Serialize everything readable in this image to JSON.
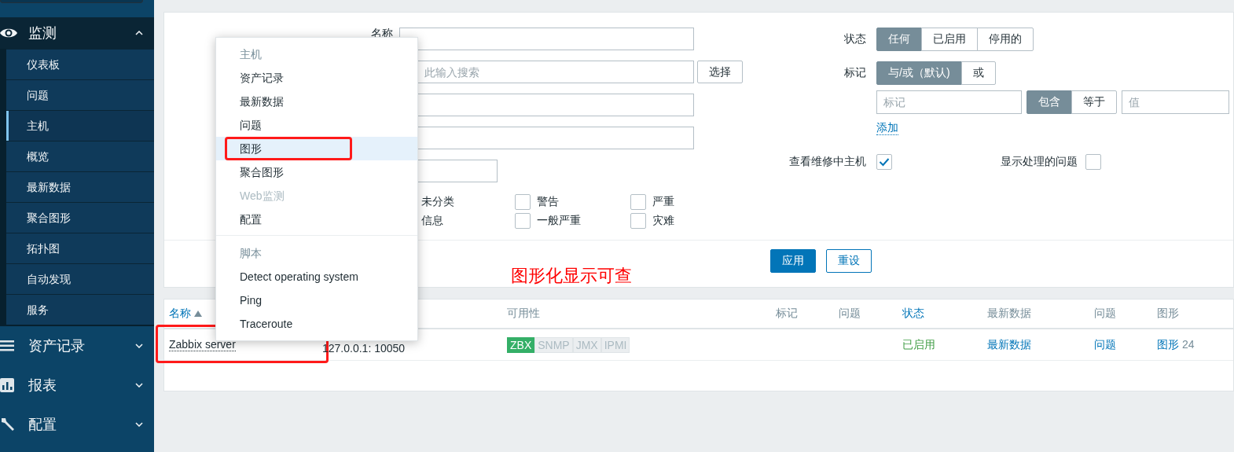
{
  "sidebar": {
    "sections": [
      {
        "label": "监测",
        "expanded": true,
        "items": [
          {
            "label": "仪表板",
            "selected": false
          },
          {
            "label": "问题",
            "selected": false
          },
          {
            "label": "主机",
            "selected": true
          },
          {
            "label": "概览",
            "selected": false
          },
          {
            "label": "最新数据",
            "selected": false
          },
          {
            "label": "聚合图形",
            "selected": false
          },
          {
            "label": "拓扑图",
            "selected": false
          },
          {
            "label": "自动发现",
            "selected": false
          },
          {
            "label": "服务",
            "selected": false
          }
        ]
      },
      {
        "label": "资产记录",
        "expanded": false
      },
      {
        "label": "报表",
        "expanded": false
      },
      {
        "label": "配置",
        "expanded": false
      }
    ]
  },
  "filter": {
    "fields": [
      {
        "kind": "text",
        "label": "名称"
      },
      {
        "kind": "picker",
        "placeholder": "此输入搜索",
        "button": "选择"
      },
      {
        "kind": "text"
      },
      {
        "kind": "text"
      },
      {
        "kind": "short"
      }
    ],
    "severities": [
      {
        "label": "未分类"
      },
      {
        "label": "警告",
        "checked": false
      },
      {
        "label": "严重",
        "checked": false
      },
      {
        "label": "信息"
      },
      {
        "label": "一般严重",
        "checked": false
      },
      {
        "label": "灾难",
        "checked": false
      }
    ],
    "status": {
      "label": "状态",
      "options": [
        {
          "label": "任何",
          "selected": true
        },
        {
          "label": "已启用",
          "selected": false
        },
        {
          "label": "停用的",
          "selected": false
        }
      ]
    },
    "tags": {
      "label": "标记",
      "operators": [
        {
          "label": "与/或（默认)",
          "selected": true
        },
        {
          "label": "或",
          "selected": false
        }
      ],
      "row": {
        "tag_placeholder": "标记",
        "conditions": [
          {
            "label": "包含",
            "selected": true
          },
          {
            "label": "等于",
            "selected": false
          }
        ],
        "value_placeholder": "值"
      },
      "add_link": "添加"
    },
    "maintenance": {
      "label": "查看维修中主机",
      "checked": true
    },
    "suppressed": {
      "label": "显示处理的问题",
      "checked": false
    },
    "buttons": [
      {
        "label": "应用",
        "kind": "primary"
      },
      {
        "label": "重设",
        "kind": "secondary"
      }
    ]
  },
  "table": {
    "columns": [
      {
        "label": "名称",
        "sortable": true,
        "sorted": true
      },
      {
        "label": "可用性",
        "sortable": false
      },
      {
        "label": "标记",
        "sortable": false
      },
      {
        "label": "问题",
        "sortable": false
      },
      {
        "label": "状态",
        "sortable": true
      },
      {
        "label": "最新数据",
        "sortable": false
      },
      {
        "label": "问题",
        "sortable": false
      },
      {
        "label": "图形",
        "sortable": false
      }
    ],
    "rows": [
      {
        "name": "Zabbix server",
        "annotated": true,
        "interface": "127.0.0.1: 10050",
        "availability": [
          {
            "label": "ZBX",
            "kind": "available"
          },
          {
            "label": "SNMP",
            "kind": "unknown"
          },
          {
            "label": "JMX",
            "kind": "unknown"
          },
          {
            "label": "IPMI",
            "kind": "unknown"
          }
        ],
        "status": {
          "label": "已启用",
          "kind": "enabled"
        },
        "latest_data": "最新数据",
        "problems": "问题",
        "graphs": {
          "label": "图形",
          "count": "24"
        }
      }
    ]
  },
  "context_menu": {
    "sections": [
      {
        "header": "主机",
        "items": [
          {
            "label": "资产记录",
            "selected": false,
            "disabled": false
          },
          {
            "label": "最新数据",
            "selected": false,
            "disabled": false
          },
          {
            "label": "问题",
            "selected": false,
            "disabled": false
          },
          {
            "label": "图形",
            "selected": true,
            "disabled": false,
            "annotated": true
          },
          {
            "label": "聚合图形",
            "selected": false,
            "disabled": false
          },
          {
            "label": "Web监测",
            "selected": false,
            "disabled": true
          },
          {
            "label": "配置",
            "selected": false,
            "disabled": false
          }
        ]
      },
      {
        "header": "脚本",
        "items": [
          {
            "label": "Detect operating system",
            "selected": false,
            "disabled": false
          },
          {
            "label": "Ping",
            "selected": false,
            "disabled": false
          },
          {
            "label": "Traceroute",
            "selected": false,
            "disabled": false
          }
        ]
      }
    ]
  },
  "annotation": {
    "note": "图形化显示可查"
  }
}
